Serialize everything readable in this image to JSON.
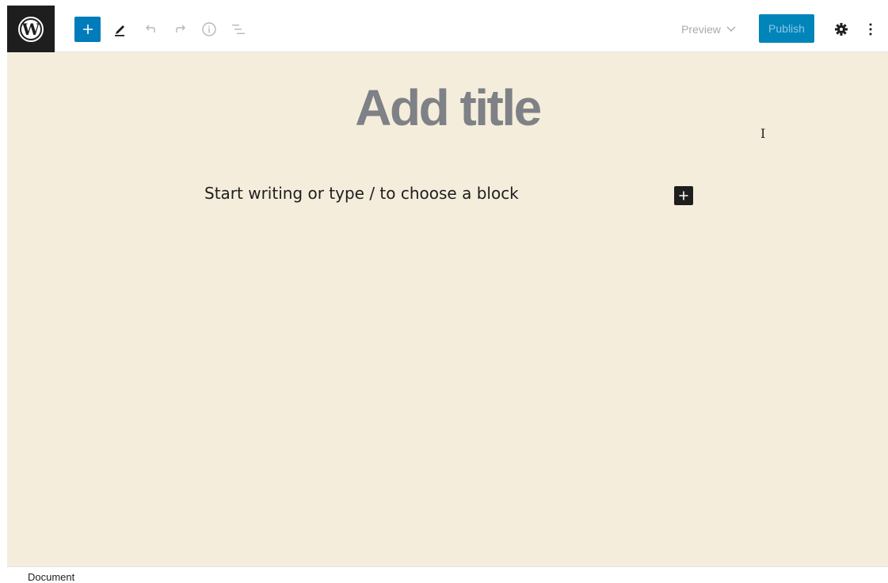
{
  "toolbar": {
    "logo_icon": "wordpress-logo-icon",
    "inserter_icon": "plus-icon",
    "tools_icon": "pencil-icon",
    "undo_icon": "undo-icon",
    "redo_icon": "redo-icon",
    "info_icon": "info-icon",
    "outline_icon": "list-view-icon",
    "preview_label": "Preview",
    "publish_label": "Publish",
    "settings_icon": "gear-icon",
    "more_icon": "more-vertical-icon"
  },
  "editor": {
    "title_placeholder": "Add title",
    "block_placeholder": "Start writing or type / to choose a block",
    "add_block_icon": "plus-icon"
  },
  "footer": {
    "breadcrumb": "Document"
  },
  "colors": {
    "canvas_bg": "#f5eddc",
    "accent": "#007cba",
    "publish_bg": "#0085ba",
    "dark": "#1e1e1e"
  }
}
